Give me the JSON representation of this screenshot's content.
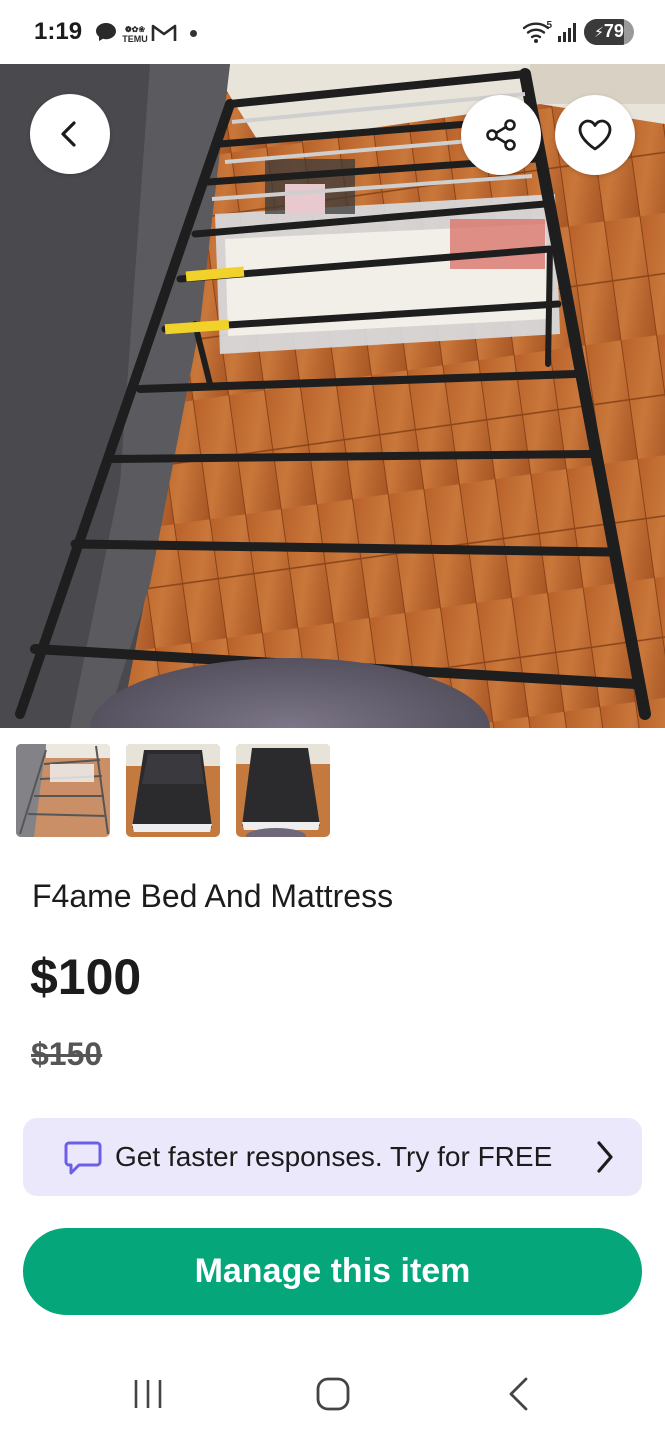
{
  "status_bar": {
    "time": "1:19",
    "icons": [
      "chat-bubble-icon",
      "temu-icon",
      "gmail-icon",
      "dot-icon",
      "wifi-icon",
      "signal-icon"
    ],
    "temu_text": "TEMU",
    "wifi_label": "5",
    "battery": "79",
    "battery_level": 0.79
  },
  "hero": {
    "actions": [
      "back",
      "share",
      "favorite"
    ]
  },
  "thumbnails": [
    {
      "name": "thumbnail-1"
    },
    {
      "name": "thumbnail-2"
    },
    {
      "name": "thumbnail-3"
    }
  ],
  "listing": {
    "title": "F4ame Bed And Mattress",
    "price": "$100",
    "original_price": "$150"
  },
  "promo": {
    "text": "Get faster responses. Try for FREE",
    "icon": "chat-bubble-icon",
    "accent": "#6b5fe6",
    "background": "#ebe8fb"
  },
  "manage_button": {
    "label": "Manage this item",
    "color": "#04a67a"
  },
  "nav_bar": {
    "buttons": [
      "recent-apps",
      "home",
      "back"
    ]
  }
}
